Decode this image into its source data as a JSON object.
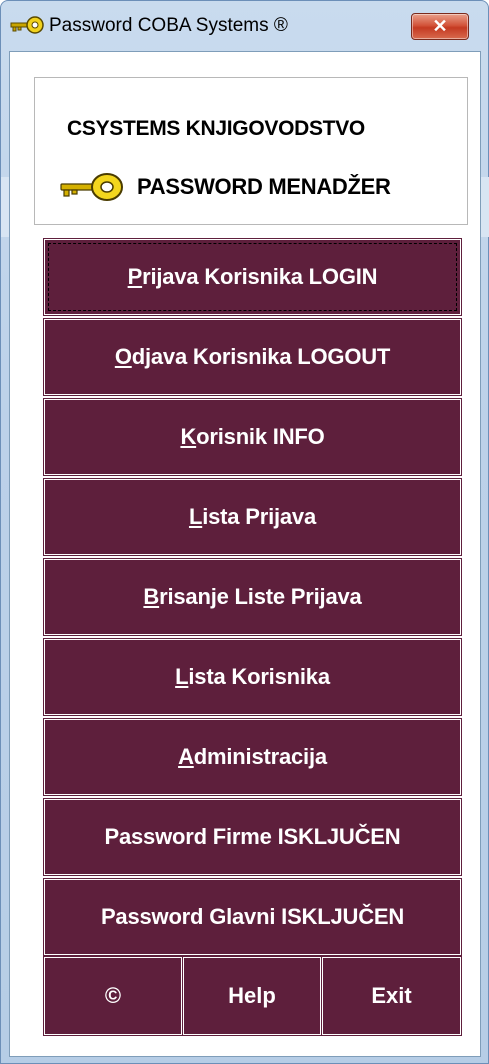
{
  "window": {
    "title": "Password COBA Systems ®",
    "close_label": "✕"
  },
  "header": {
    "group_title": "CSYSTEMS KNJIGOVODSTVO",
    "subtitle": "PASSWORD MENADŽER",
    "icon": "key-icon"
  },
  "menu": [
    {
      "first": "P",
      "rest": "rijava Korisnika LOGIN",
      "focused": true
    },
    {
      "first": "O",
      "rest": "djava Korisnika LOGOUT"
    },
    {
      "first": "K",
      "rest": "orisnik INFO"
    },
    {
      "first": "L",
      "rest": "ista Prijava"
    },
    {
      "first": "B",
      "rest": "risanje Liste Prijava"
    },
    {
      "first": "L",
      "rest": "ista Korisnika"
    },
    {
      "first": "A",
      "rest": "dministracija"
    },
    {
      "first": "",
      "rest": "Password Firme ISKLJUČEN"
    },
    {
      "first": "",
      "rest": "Password Glavni ISKLJUČEN"
    }
  ],
  "footer": {
    "copyright_label": "©",
    "help_label": "Help",
    "exit_label": "Exit"
  },
  "colors": {
    "button_bg": "#5e1f3c",
    "button_text": "#ffffff",
    "frame": "#bcd1e9"
  }
}
